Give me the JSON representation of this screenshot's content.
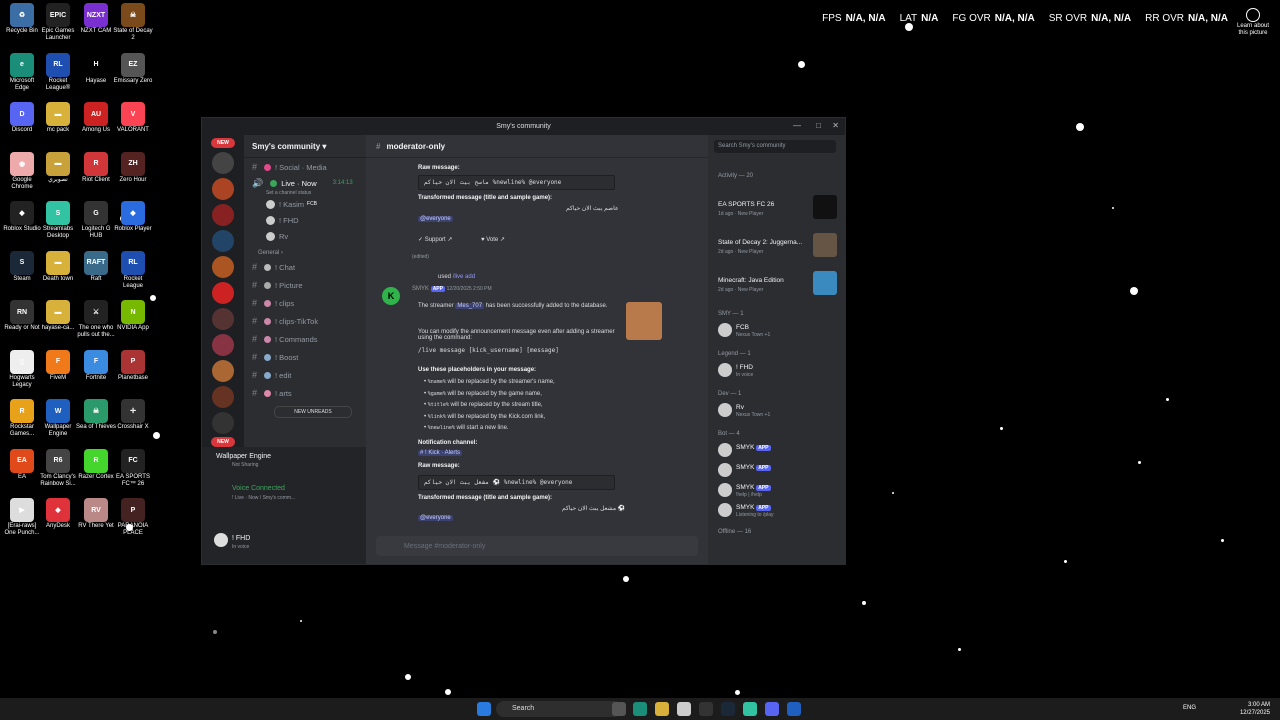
{
  "hud": {
    "fps_label": "FPS",
    "fps_val": "N/A, N/A",
    "lat_label": "LAT",
    "lat_val": "N/A",
    "fg_label": "FG OVR",
    "fg_val": "N/A, N/A",
    "sr_label": "SR OVR",
    "sr_val": "N/A, N/A",
    "rr_label": "RR OVR",
    "rr_val": "N/A, N/A"
  },
  "learn_more": "Learn about this picture",
  "desktop": [
    {
      "label": "Recycle Bin",
      "color": "#3a6ea5",
      "icon": "recycle-bin-icon",
      "glyph": "♻"
    },
    {
      "label": "Epic Games Launcher",
      "color": "#222",
      "icon": "epic-games-icon",
      "glyph": "EPIC"
    },
    {
      "label": "NZXT CAM",
      "color": "#7a2fd0",
      "icon": "nzxt-icon",
      "glyph": "NZXT"
    },
    {
      "label": "State of Decay 2",
      "color": "#7a4a1a",
      "icon": "game-icon",
      "glyph": "☠"
    },
    {
      "label": "Microsoft Edge",
      "color": "#1b8e7a",
      "icon": "edge-icon",
      "glyph": "e"
    },
    {
      "label": "Rocket League®",
      "color": "#1e4fb0",
      "icon": "rocket-league-icon",
      "glyph": "RL"
    },
    {
      "label": "Hayase",
      "color": "#000",
      "icon": "hayase-icon",
      "glyph": "H"
    },
    {
      "label": "Emissary Zero",
      "color": "#555",
      "icon": "game-icon",
      "glyph": "EZ"
    },
    {
      "label": "Discord",
      "color": "#5865f2",
      "icon": "discord-icon",
      "glyph": "D"
    },
    {
      "label": "mc pack",
      "color": "#d8b13a",
      "icon": "folder-icon",
      "glyph": "▬"
    },
    {
      "label": "Among Us",
      "color": "#c22",
      "icon": "among-us-icon",
      "glyph": "AU"
    },
    {
      "label": "VALORANT",
      "color": "#fa4454",
      "icon": "valorant-icon",
      "glyph": "V"
    },
    {
      "label": "Google Chrome",
      "color": "#eaa",
      "icon": "chrome-icon",
      "glyph": "◉"
    },
    {
      "label": "تصويري",
      "color": "#c9a13a",
      "icon": "folder-icon",
      "glyph": "▬"
    },
    {
      "label": "Riot Client",
      "color": "#d13639",
      "icon": "riot-icon",
      "glyph": "R"
    },
    {
      "label": "Zero Hour",
      "color": "#522",
      "icon": "game-icon",
      "glyph": "ZH"
    },
    {
      "label": "Roblox Studio",
      "color": "#222",
      "icon": "roblox-icon",
      "glyph": "◆"
    },
    {
      "label": "Streamlabs Desktop",
      "color": "#31c3a2",
      "icon": "streamlabs-icon",
      "glyph": "S"
    },
    {
      "label": "Logitech G HUB",
      "color": "#333",
      "icon": "logitech-icon",
      "glyph": "G"
    },
    {
      "label": "Roblox Player",
      "color": "#2b6be0",
      "icon": "roblox-icon",
      "glyph": "◆"
    },
    {
      "label": "Steam",
      "color": "#1b2838",
      "icon": "steam-icon",
      "glyph": "S"
    },
    {
      "label": "Death town",
      "color": "#d8b13a",
      "icon": "folder-icon",
      "glyph": "▬"
    },
    {
      "label": "Raft",
      "color": "#3a6a8a",
      "icon": "raft-icon",
      "glyph": "RAFT"
    },
    {
      "label": "Rocket League",
      "color": "#1e4fb0",
      "icon": "rocket-league-icon",
      "glyph": "RL"
    },
    {
      "label": "Ready or Not",
      "color": "#333",
      "icon": "game-icon",
      "glyph": "RN"
    },
    {
      "label": "hayase-ca...",
      "color": "#d8b13a",
      "icon": "folder-icon",
      "glyph": "▬"
    },
    {
      "label": "The one who pulls out the...",
      "color": "#222",
      "icon": "game-icon",
      "glyph": "⚔"
    },
    {
      "label": "NVIDIA App",
      "color": "#76b900",
      "icon": "nvidia-icon",
      "glyph": "N"
    },
    {
      "label": "Hogwarts Legacy",
      "color": "#eee",
      "icon": "file-icon",
      "glyph": "▯"
    },
    {
      "label": "FiveM",
      "color": "#f07a1a",
      "icon": "fivem-icon",
      "glyph": "F"
    },
    {
      "label": "Fortnite",
      "color": "#3b8be0",
      "icon": "fortnite-icon",
      "glyph": "F"
    },
    {
      "label": "Planetbase",
      "color": "#a33",
      "icon": "game-icon",
      "glyph": "P"
    },
    {
      "label": "Rockstar Games...",
      "color": "#e8a21a",
      "icon": "rockstar-icon",
      "glyph": "R"
    },
    {
      "label": "Wallpaper Engine",
      "color": "#1f5fbf",
      "icon": "wallpaper-engine-icon",
      "glyph": "W"
    },
    {
      "label": "Sea of Thieves",
      "color": "#2a9a6a",
      "icon": "sea-of-thieves-icon",
      "glyph": "☠"
    },
    {
      "label": "Crosshair X",
      "color": "#333",
      "icon": "crosshair-icon",
      "glyph": "✛"
    },
    {
      "label": "EA",
      "color": "#e04a1a",
      "icon": "ea-icon",
      "glyph": "EA"
    },
    {
      "label": "Tom Clancy's Rainbow Si...",
      "color": "#444",
      "icon": "game-icon",
      "glyph": "R6"
    },
    {
      "label": "Razer Cortex",
      "color": "#44d62c",
      "icon": "razer-icon",
      "glyph": "R"
    },
    {
      "label": "EA SPORTS FC™ 26",
      "color": "#222",
      "icon": "ea-fc-icon",
      "glyph": "FC"
    },
    {
      "label": "[Erai-raws] One Punch...",
      "color": "#ddd",
      "icon": "video-icon",
      "glyph": "▶"
    },
    {
      "label": "AnyDesk",
      "color": "#e0323a",
      "icon": "anydesk-icon",
      "glyph": "◆"
    },
    {
      "label": "RV There Yet",
      "color": "#b88",
      "icon": "game-icon",
      "glyph": "RV"
    },
    {
      "label": "PARANOIA PLACE",
      "color": "#422",
      "icon": "game-icon",
      "glyph": "P"
    }
  ],
  "discord": {
    "window_title": "Smy's community",
    "server_name": "Smy's community",
    "new_label": "NEW",
    "channels": [
      {
        "name": "! Social · Media",
        "color": "#e04a8a"
      },
      {
        "name": "Live · Now",
        "color": "#3ba55c",
        "time": "3:14:13",
        "sub": "Set a channel status"
      }
    ],
    "voice_users": [
      {
        "name": "! Kasim",
        "tag": "FCB"
      },
      {
        "name": "! FHD"
      },
      {
        "name": "Rv"
      }
    ],
    "category": "General",
    "channels2": [
      {
        "name": "! Chat",
        "color": "#bbb"
      },
      {
        "name": "! Picture",
        "color": "#aaa"
      },
      {
        "name": "! clips",
        "color": "#c8a"
      },
      {
        "name": "! clips-TikTok",
        "color": "#c8a"
      },
      {
        "name": "! Commands",
        "color": "#c8a"
      },
      {
        "name": "! Boost",
        "color": "#8ac"
      },
      {
        "name": "! edit",
        "color": "#8ac"
      },
      {
        "name": "! arts",
        "color": "#d8a"
      }
    ],
    "new_unreads": "NEW UNREADS",
    "wallpaper_engine": "Wallpaper Engine",
    "not_sharing": "Not Sharing",
    "voice_connected": "Voice Connected",
    "voice_channel": "! Live · Now / Smy's comm...",
    "user_name": "! FHD",
    "user_status": "In voice",
    "channel_header": "moderator-only",
    "raw_message_label": "Raw message:",
    "raw_message_1": "ماسح بيث الان حياكم %newline% @everyone",
    "transformed_label": "Transformed message (title and sample game):",
    "transformed_1": "عاصم يبث الان حياكم",
    "everyone": "@everyone",
    "support_btn": "Support",
    "vote_btn": "Vote",
    "edited": "(edited)",
    "used": "used",
    "command": "/live add",
    "bot_name": "SMYK",
    "app_badge": "APP",
    "timestamp": "12/20/2025 2:50 PM",
    "added_text_1": "The streamer",
    "streamer": "Mes_707",
    "added_text_2": "has been successfully added to the database.",
    "modify_text": "You can modify the announcement message even after adding a streamer using the command:",
    "modify_cmd": "/live message [kick_username] [message]",
    "placeholders_label": "Use these placeholders in your message:",
    "placeholders": [
      {
        "code": "%name%",
        "text": "will be replaced by the streamer's name,"
      },
      {
        "code": "%game%",
        "text": "will be replaced by the game name,"
      },
      {
        "code": "%title%",
        "text": "will be replaced by the stream title,"
      },
      {
        "code": "%link%",
        "text": "will be replaced by the Kick.com link,"
      },
      {
        "code": "%newline%",
        "text": "will start a new line."
      }
    ],
    "notif_label": "Notification channel:",
    "notif_channel": "! Kick · Alerts",
    "raw_message_2": "مشعل يبث الان حياكم ⚽ %newline% @everyone",
    "transformed_2": "مشعل يبث الان حياكم ⚽",
    "input_placeholder": "Message #moderator-only",
    "search_placeholder": "Search Smy's community",
    "activity_label": "Activity — 20",
    "activities": [
      {
        "title": "EA SPORTS FC 26",
        "sub": "1d ago",
        "tag": "New Player",
        "color": "#fff",
        "thumb": "#111"
      },
      {
        "title": "State of Decay 2: Juggerna...",
        "sub": "2d ago",
        "tag": "New Player",
        "color": "#fff",
        "thumb": "#654"
      },
      {
        "title": "Minecraft: Java Edition",
        "sub": "2d ago",
        "tag": "New Player",
        "color": "#fff",
        "thumb": "#3a8ac0"
      }
    ],
    "groups": [
      {
        "label": "SMY — 1",
        "members": [
          {
            "name": "FCB",
            "sub": "Nexus Town +1"
          }
        ]
      },
      {
        "label": "Legend — 1",
        "members": [
          {
            "name": "! FHD",
            "sub": "In voice"
          }
        ]
      },
      {
        "label": "Dev — 1",
        "members": [
          {
            "name": "Rv",
            "sub": "Nexus Town +1"
          }
        ]
      },
      {
        "label": "Bot — 4",
        "members": [
          {
            "name": "SMYK",
            "sub": ""
          },
          {
            "name": "SMYK",
            "sub": ""
          },
          {
            "name": "SMYK",
            "sub": "!help | /help"
          },
          {
            "name": "SMYK",
            "sub": "Listening to /play"
          }
        ]
      }
    ],
    "offline": "Offline — 16"
  },
  "taskbar": {
    "search": "Search",
    "lang": "ENG",
    "time": "3:00 AM",
    "date": "12/27/2025"
  }
}
